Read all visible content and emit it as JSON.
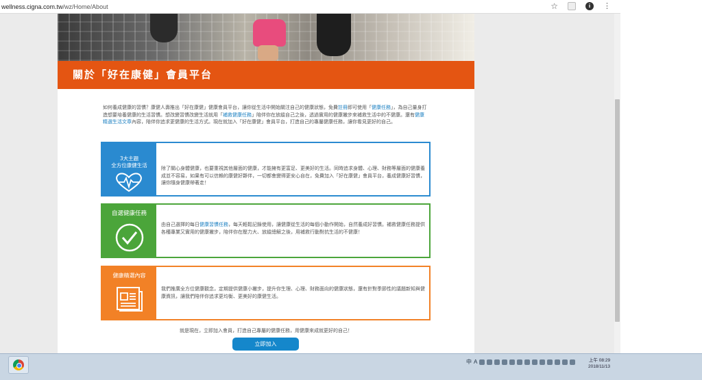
{
  "browser": {
    "url_host": "wellness.cigna.com.tw",
    "url_path": "/wz/Home/About",
    "info_icon_label": "i"
  },
  "page": {
    "title": "關於「好在康健」會員平台",
    "intro_1": "如何養成健康的習慣？康健人壽推出「好在康健」健康會員平台，讓你從生活中開始關注自己的健康狀態，免費",
    "intro_link_register": "註冊",
    "intro_2": "即可使用「",
    "intro_link_tasks": "健康任務",
    "intro_3": "」，為自己量身打造想要培養健康的生活習慣。想改變習慣改變生活就用「",
    "intro_link_tasks2": "補救健康任務",
    "intro_4": "」陪伴你在放縱自己之後，透過實用的健康撇步來補救生活中的不健康。還有",
    "intro_link_articles": "健康精選生活文章",
    "intro_5": "內容，陪伴你追求更健康的生活方式。現在就加入「好在康健」會員平台，打造自己的專屬健康任務，讓你看見更好的自己。",
    "cards": [
      {
        "side_label_1": "3大主題",
        "side_label_2": "全方位康健生活",
        "icon": "heart-pulse-icon",
        "body": "除了關心身體健康，也要重視其他層面的健康，才能擁有更富足、更美好的生活。同時追求身體、心理、財務等層面的健康養成並不容易，如果有可以信賴的康健好夥伴，一切都會變得更安心自在，免費加入「好在康健」會員平台，養成健康好習慣，讓你隨身健康帶著走！"
      },
      {
        "side_label_1": "自選健康任務",
        "icon": "checkmark-circle-icon",
        "body_1": "由自己選擇的每日",
        "body_link": "健康習慣任務",
        "body_2": "，每天輕鬆記錄使用，讓健康從生活的每個小動作開始，自然養成好習慣。補救健康任務提供各種專業又實用的健康撇步，陪伴你在壓力大、放縱總解之後，用補救行動對抗生活的不健康！"
      },
      {
        "side_label_1": "健康精選內容",
        "icon": "newspaper-icon",
        "body": "我們推廣全方位健康觀念，定期提供健康小撇步，提升你生理、心理、財務面向的健康狀態，還有針對季節性的議題新知與健康資訊，讓我們陪伴你追求更均衡、更美好的康健生活。"
      }
    ],
    "closing": "就是現在，立即加入會員，打造自己專屬的健康任務，用健康來成就更好的自己！",
    "join_button": "立即加入"
  },
  "taskbar": {
    "tray_lang_1": "中",
    "tray_lang_2": "A",
    "clock_time": "上午 08:29",
    "clock_date": "2018/11/13"
  },
  "colors": {
    "orange_title": "#e45512",
    "blue": "#2a8ad0",
    "green": "#4ba53a",
    "orange": "#f28126",
    "link": "#1a7fc1",
    "button": "#1587cb"
  }
}
